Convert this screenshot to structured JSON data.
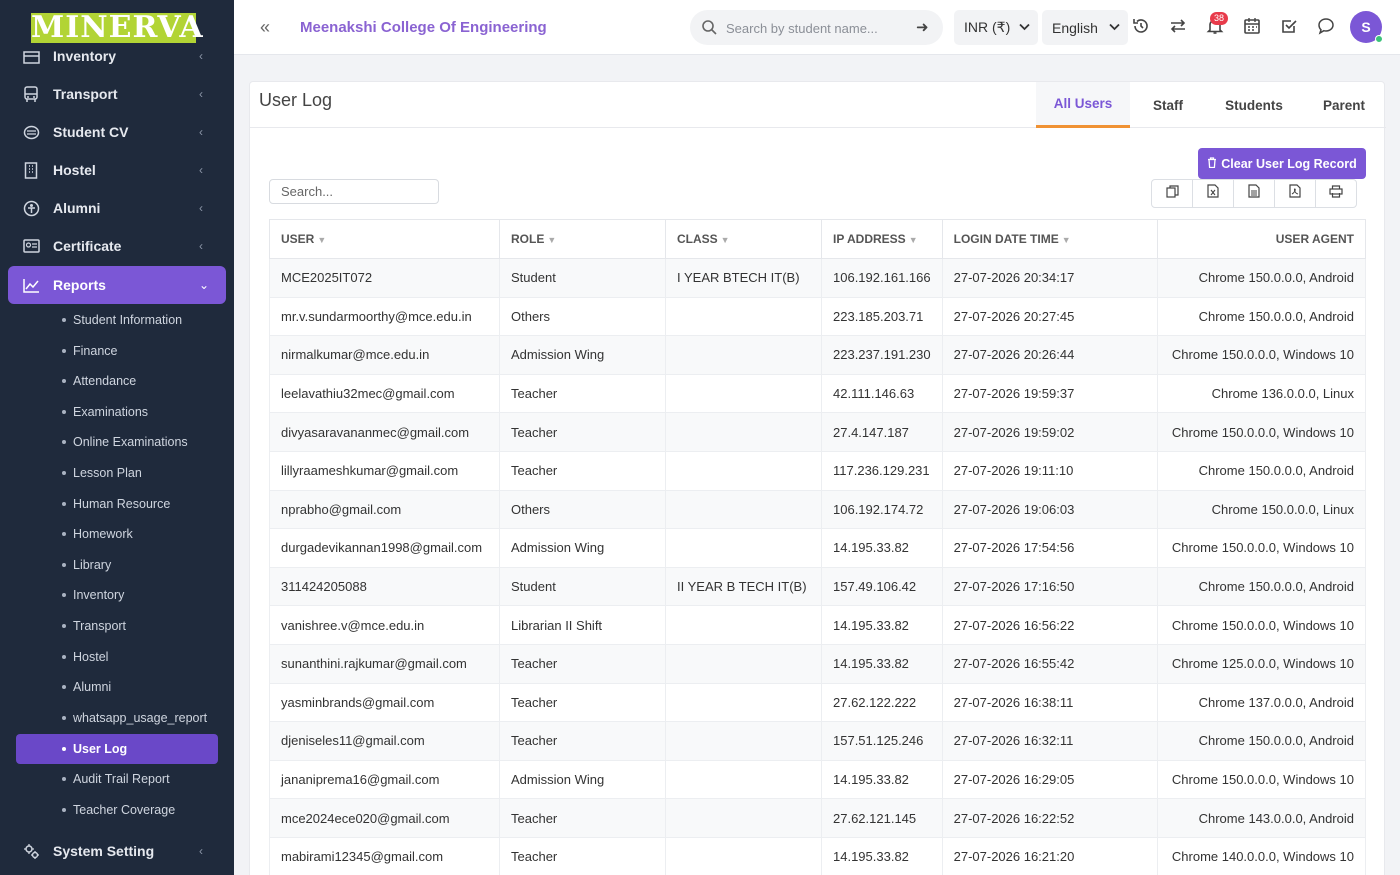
{
  "brand": {
    "logo_text": "MINERVA"
  },
  "sidebar": {
    "items": [
      {
        "label": "Inventory",
        "icon": "inventory-icon"
      },
      {
        "label": "Transport",
        "icon": "bus-icon"
      },
      {
        "label": "Student CV",
        "icon": "cv-icon"
      },
      {
        "label": "Hostel",
        "icon": "building-icon"
      },
      {
        "label": "Alumni",
        "icon": "alumni-icon"
      },
      {
        "label": "Certificate",
        "icon": "certificate-icon"
      },
      {
        "label": "Reports",
        "icon": "chart-line-icon"
      }
    ],
    "reports_sub": [
      "Student Information",
      "Finance",
      "Attendance",
      "Examinations",
      "Online Examinations",
      "Lesson Plan",
      "Human Resource",
      "Homework",
      "Library",
      "Inventory",
      "Transport",
      "Hostel",
      "Alumni",
      "whatsapp_usage_report",
      "User Log",
      "Audit Trail Report",
      "Teacher Coverage"
    ],
    "system_setting": "System Setting"
  },
  "header": {
    "college": "Meenakshi College Of Engineering",
    "search_placeholder": "Search by student name...",
    "currency": "INR (₹)",
    "language": "English",
    "notification_count": "38",
    "avatar_initial": "S"
  },
  "page": {
    "title": "User Log",
    "tabs": [
      "All Users",
      "Staff",
      "Students",
      "Parent"
    ],
    "active_tab": "All Users",
    "clear_button": "Clear User Log Record",
    "table_search_placeholder": "Search...",
    "columns": [
      "User",
      "Role",
      "Class",
      "IP Address",
      "Login Date Time",
      "User Agent"
    ],
    "rows": [
      [
        "MCE2025IT072",
        "Student",
        "I YEAR BTECH IT(B)",
        "106.192.161.166",
        "27-07-2026 20:34:17",
        "Chrome 150.0.0.0, Android"
      ],
      [
        "mr.v.sundarmoorthy@mce.edu.in",
        "Others",
        "",
        "223.185.203.71",
        "27-07-2026 20:27:45",
        "Chrome 150.0.0.0, Android"
      ],
      [
        "nirmalkumar@mce.edu.in",
        "Admission Wing",
        "",
        "223.237.191.230",
        "27-07-2026 20:26:44",
        "Chrome 150.0.0.0, Windows 10"
      ],
      [
        "leelavathiu32mec@gmail.com",
        "Teacher",
        "",
        "42.111.146.63",
        "27-07-2026 19:59:37",
        "Chrome 136.0.0.0, Linux"
      ],
      [
        "divyasaravananmec@gmail.com",
        "Teacher",
        "",
        "27.4.147.187",
        "27-07-2026 19:59:02",
        "Chrome 150.0.0.0, Windows 10"
      ],
      [
        "lillyraameshkumar@gmail.com",
        "Teacher",
        "",
        "117.236.129.231",
        "27-07-2026 19:11:10",
        "Chrome 150.0.0.0, Android"
      ],
      [
        "nprabho@gmail.com",
        "Others",
        "",
        "106.192.174.72",
        "27-07-2026 19:06:03",
        "Chrome 150.0.0.0, Linux"
      ],
      [
        "durgadevikannan1998@gmail.com",
        "Admission Wing",
        "",
        "14.195.33.82",
        "27-07-2026 17:54:56",
        "Chrome 150.0.0.0, Windows 10"
      ],
      [
        "311424205088",
        "Student",
        "II YEAR B TECH IT(B)",
        "157.49.106.42",
        "27-07-2026 17:16:50",
        "Chrome 150.0.0.0, Android"
      ],
      [
        "vanishree.v@mce.edu.in",
        "Librarian II Shift",
        "",
        "14.195.33.82",
        "27-07-2026 16:56:22",
        "Chrome 150.0.0.0, Windows 10"
      ],
      [
        "sunanthini.rajkumar@gmail.com",
        "Teacher",
        "",
        "14.195.33.82",
        "27-07-2026 16:55:42",
        "Chrome 125.0.0.0, Windows 10"
      ],
      [
        "yasminbrands@gmail.com",
        "Teacher",
        "",
        "27.62.122.222",
        "27-07-2026 16:38:11",
        "Chrome 137.0.0.0, Android"
      ],
      [
        "djeniseles11@gmail.com",
        "Teacher",
        "",
        "157.51.125.246",
        "27-07-2026 16:32:11",
        "Chrome 150.0.0.0, Android"
      ],
      [
        "jananiprema16@gmail.com",
        "Admission Wing",
        "",
        "14.195.33.82",
        "27-07-2026 16:29:05",
        "Chrome 150.0.0.0, Windows 10"
      ],
      [
        "mce2024ece020@gmail.com",
        "Teacher",
        "",
        "27.62.121.145",
        "27-07-2026 16:22:52",
        "Chrome 143.0.0.0, Android"
      ],
      [
        "mabirami12345@gmail.com",
        "Teacher",
        "",
        "14.195.33.82",
        "27-07-2026 16:21:20",
        "Chrome 140.0.0.0, Windows 10"
      ]
    ]
  },
  "colors": {
    "sidebar_bg": "#1f2a3c",
    "accent": "#7b57d6",
    "tab_underline": "#f09234",
    "logo_bg": "#b2d435",
    "badge": "#e83b4b"
  }
}
